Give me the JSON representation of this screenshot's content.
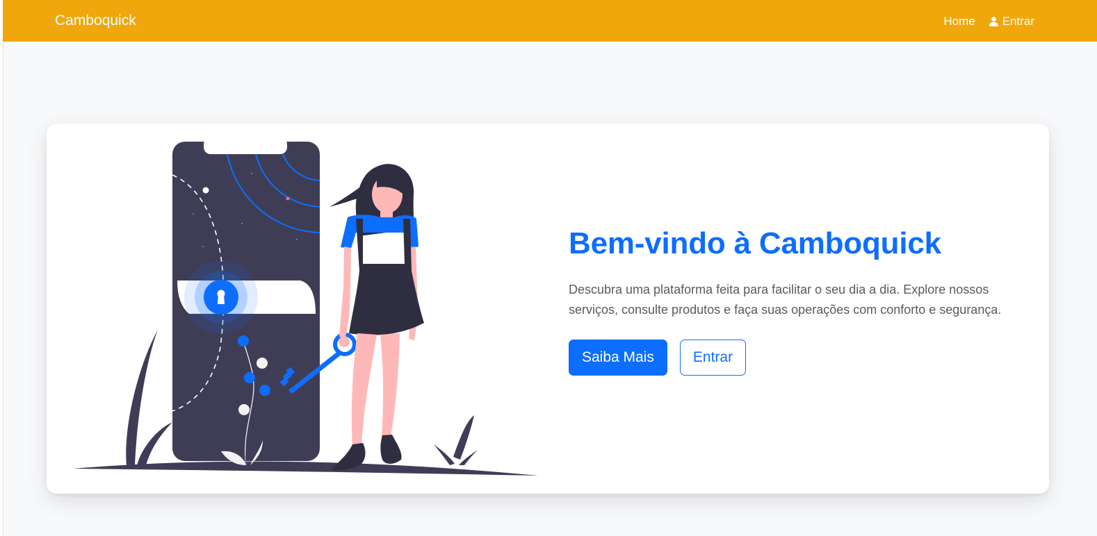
{
  "nav": {
    "brand": "Camboquick",
    "links": [
      {
        "label": "Home"
      },
      {
        "label": "Entrar",
        "icon": "user-icon"
      }
    ]
  },
  "hero": {
    "title": "Bem-vindo à Camboquick",
    "description": "Descubra uma plataforma feita para facilitar o seu dia a dia. Explore nossos serviços, consulte produtos e faça suas operações com conforto e segurança.",
    "primary_button": "Saiba Mais",
    "secondary_button": "Entrar"
  },
  "colors": {
    "navbar": "#f0a70b",
    "accent": "#0d6efd",
    "illustration_dark": "#3f3d56",
    "skin": "#ffb8b8"
  }
}
